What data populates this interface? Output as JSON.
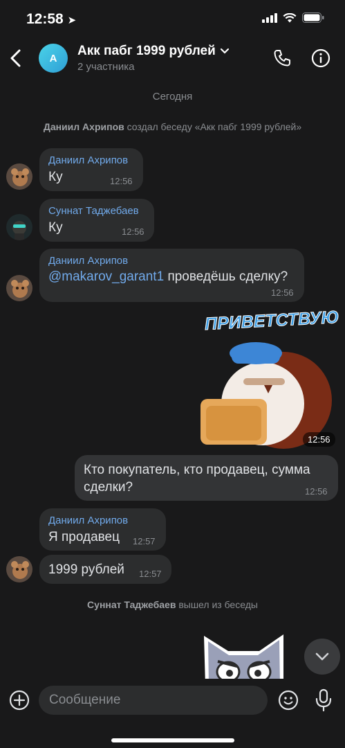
{
  "status_bar": {
    "time": "12:58"
  },
  "header": {
    "avatar_letter": "A",
    "title": "Акк пабг 1999 рублей",
    "subtitle": "2 участника"
  },
  "date_separator": "Сегодня",
  "service_created": {
    "actor": "Даниил Ахрипов",
    "text": "создал беседу «Акк пабг 1999 рублей»"
  },
  "messages": [
    {
      "sender": "Даниил Ахрипов",
      "text": "Ку",
      "time": "12:56"
    },
    {
      "sender": "Суннат Таджебаев",
      "text": "Ку",
      "time": "12:56"
    },
    {
      "sender": "Даниил Ахрипов",
      "mention": "@makarov_garant1",
      "text": "проведёшь сделку?",
      "time": "12:56"
    },
    {
      "sticker_caption": "ПРИВЕТСТВУЮ",
      "time": "12:56"
    },
    {
      "line1": "Кто покупатель, кто продавец, сумма",
      "line2": "сделки?",
      "time": "12:56"
    },
    {
      "sender": "Даниил Ахрипов",
      "text": "Я продавец",
      "time": "12:57"
    },
    {
      "text": "1999 рублей",
      "time": "12:57"
    }
  ],
  "service_left": {
    "actor": "Суннат Таджебаев",
    "text": "вышел из беседы"
  },
  "composer": {
    "placeholder": "Сообщение"
  },
  "colors": {
    "background": "#19191a",
    "bubble_in": "#2c2d2e",
    "bubble_out": "#333436",
    "accent": "#71aaeb",
    "muted": "#8a8d91"
  }
}
